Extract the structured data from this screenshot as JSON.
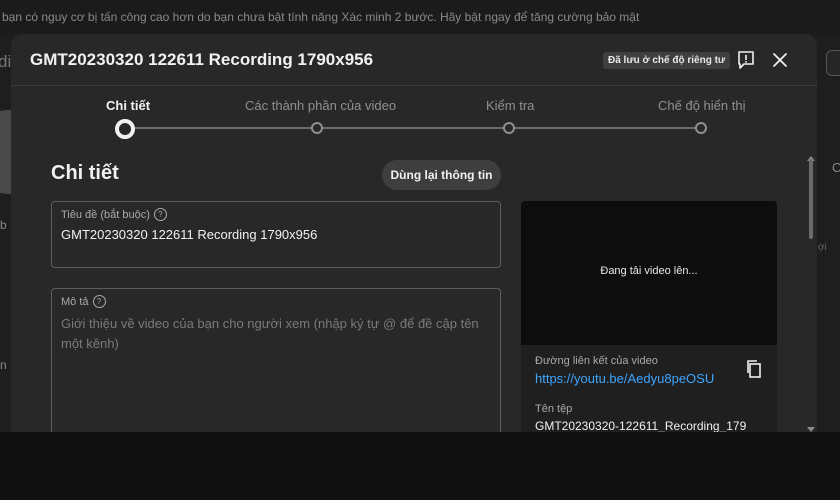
{
  "banner": {
    "text": "bạn có nguy cơ bị tấn công cao hơn do bạn chưa bật tính năng Xác minh 2 bước. Hãy bật ngay để tăng cường bảo mật"
  },
  "background": {
    "frag_left_1": "di",
    "frag_left_2": "b",
    "frag_left_3": "n",
    "frag_right_1": "C",
    "frag_right_2": "ợi"
  },
  "dialog": {
    "title": "GMT20230320 122611 Recording 1790x956",
    "saved_badge": "Đã lưu ở chế độ riêng tư",
    "header_icons": [
      "feedback-icon",
      "close-icon"
    ]
  },
  "stepper": {
    "steps": [
      {
        "label": "Chi tiết",
        "active": true
      },
      {
        "label": "Các thành phần của video",
        "active": false
      },
      {
        "label": "Kiểm tra",
        "active": false
      },
      {
        "label": "Chế độ hiển thị",
        "active": false
      }
    ]
  },
  "details": {
    "section_title": "Chi tiết",
    "reuse_button": "Dùng lại thông tin",
    "title_field": {
      "label": "Tiêu đề (bắt buộc)",
      "value": "GMT20230320 122611 Recording 1790x956"
    },
    "description_field": {
      "label": "Mô tả",
      "placeholder": "Giới thiệu về video của bạn cho người xem (nhập ký tự @ để đề cập tên một kênh)"
    }
  },
  "preview": {
    "status": "Đang tải video lên...",
    "link_label": "Đường liên kết của video",
    "link_value": "https://youtu.be/Aedyu8peOSU",
    "file_label": "Tên tệp",
    "file_value": "GMT20230320-122611_Recording_179"
  },
  "colors": {
    "dialog_bg": "#282828",
    "link": "#3ea6ff",
    "page_bg": "#0f0f0f"
  }
}
